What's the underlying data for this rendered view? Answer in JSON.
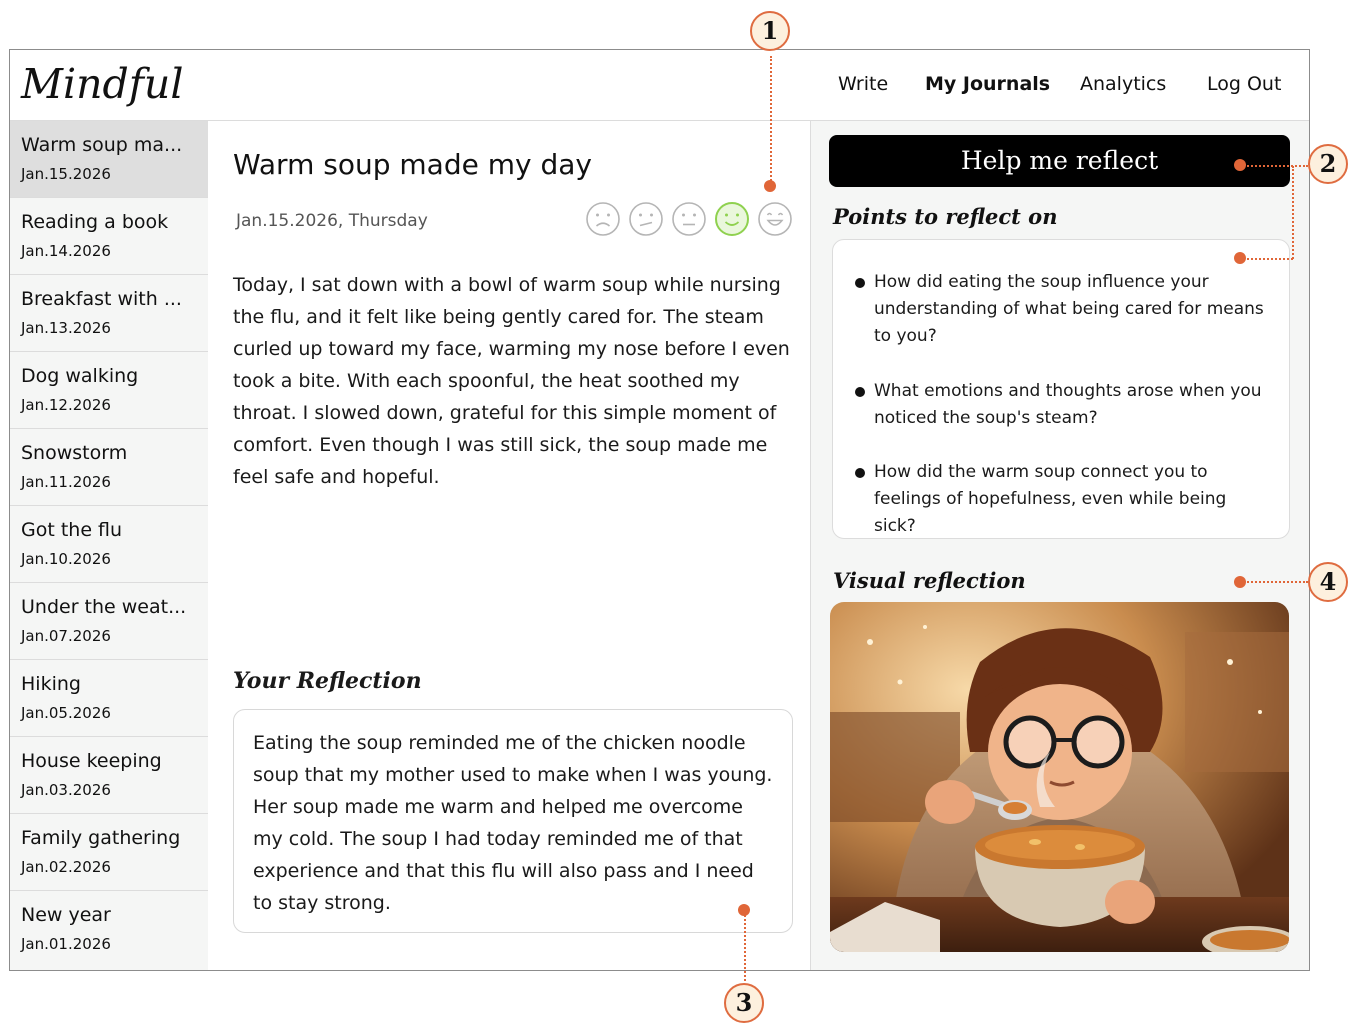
{
  "app": {
    "logo": "Mindful"
  },
  "nav": {
    "write": "Write",
    "journals": "My Journals",
    "analytics": "Analytics",
    "logout": "Log Out"
  },
  "sidebar": {
    "items": [
      {
        "title": "Warm soup ma...",
        "date": "Jan.15.2026"
      },
      {
        "title": "Reading a book",
        "date": "Jan.14.2026"
      },
      {
        "title": "Breakfast with ...",
        "date": "Jan.13.2026"
      },
      {
        "title": "Dog walking",
        "date": "Jan.12.2026"
      },
      {
        "title": "Snowstorm",
        "date": "Jan.11.2026"
      },
      {
        "title": "Got the flu",
        "date": "Jan.10.2026"
      },
      {
        "title": "Under the weat...",
        "date": "Jan.07.2026"
      },
      {
        "title": "Hiking",
        "date": "Jan.05.2026"
      },
      {
        "title": "House keeping",
        "date": "Jan.03.2026"
      },
      {
        "title": "Family gathering",
        "date": "Jan.02.2026"
      },
      {
        "title": "New year",
        "date": "Jan.01.2026"
      }
    ]
  },
  "entry": {
    "title": "Warm soup made my day",
    "date": "Jan.15.2026, Thursday",
    "mood_selected": "content",
    "body": "Today, I sat down with a bowl of warm soup while nursing the flu, and it felt like being gently cared for. The steam curled up toward my face, warming my nose before I even took a bite. With each spoonful, the heat soothed my throat. I slowed down, grateful for this simple moment of comfort. Even though I was still sick, the soup made me feel safe and hopeful.",
    "reflection_heading": "Your Reflection",
    "reflection": "Eating the soup reminded me of the chicken noodle soup that my mother used to make when I was young. Her soup made me warm and helped me overcome my cold. The soup I had today reminded me of that experience and that this flu will also pass and I need to stay strong."
  },
  "reflect": {
    "button": "Help me reflect",
    "points_heading": "Points to reflect on",
    "points": [
      "How did eating the soup influence your understanding of what being cared for means to you?",
      "What emotions and thoughts arose when you noticed the soup's steam?",
      "How did the warm soup connect you to feelings of hopefulness, even while being sick?"
    ],
    "visual_heading": "Visual reflection"
  },
  "callouts": {
    "c1": "1",
    "c2": "2",
    "c3": "3",
    "c4": "4"
  },
  "colors": {
    "accent": "#e06638",
    "mood_selected": "#8fd14f",
    "mood_selected_fill": "#eaf7dc",
    "mood_default": "#b5b5b5"
  }
}
